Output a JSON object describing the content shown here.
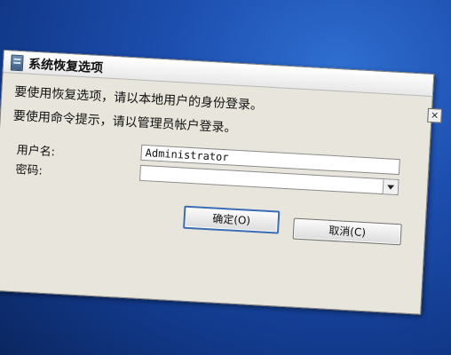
{
  "dialog": {
    "title": "系统恢复选项",
    "line1": "要使用恢复选项，请以本地用户的身份登录。",
    "line2": "要使用命令提示，请以管理员帐户登录。",
    "username_label": "用户名:",
    "username_value": "Administrator",
    "password_label": "密码:",
    "password_value": "",
    "ok_label": "确定(O)",
    "cancel_label": "取消(C)",
    "close_glyph": "×"
  }
}
